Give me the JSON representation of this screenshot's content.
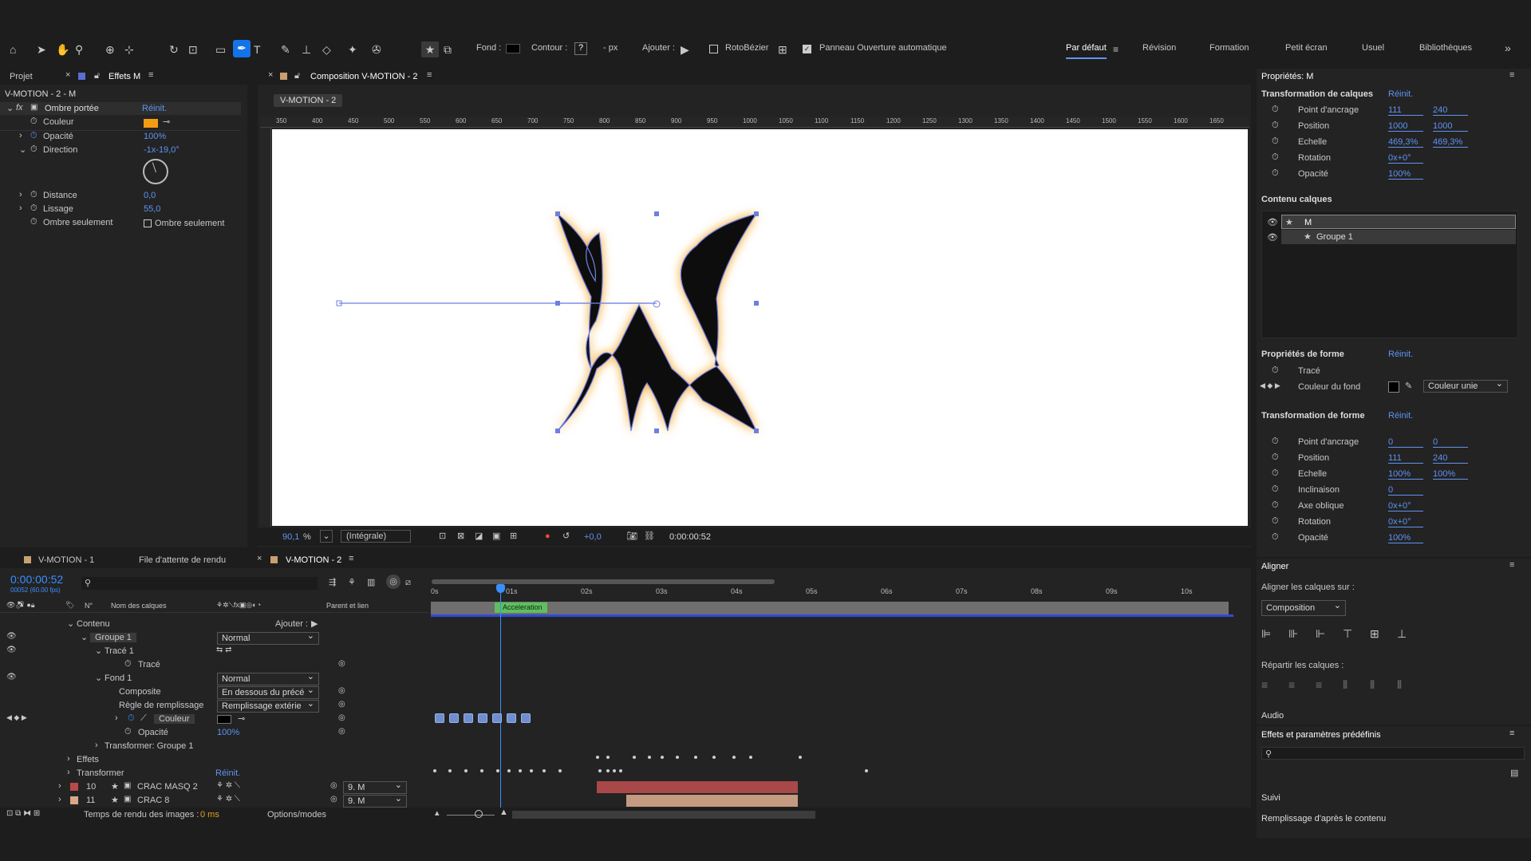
{
  "toolbar": {
    "fill_label": "Fond :",
    "stroke_label": "Contour :",
    "stroke_value": "?",
    "px_label": "- px",
    "add_label": "Ajouter :",
    "roto_label": "RotoBézier",
    "auto_open_label": "Panneau Ouverture automatique",
    "workspaces": [
      "Par défaut",
      "Révision",
      "Formation",
      "Petit écran",
      "Usuel",
      "Bibliothèques"
    ],
    "more": "»"
  },
  "effects_panel": {
    "tab_project": "Projet",
    "tab_effects": "Effets M",
    "title": "V-MOTION - 2 - M",
    "effect_name": "Ombre portée",
    "reset": "Réinit.",
    "rows": [
      {
        "label": "Couleur"
      },
      {
        "label": "Opacité",
        "value": "100%"
      },
      {
        "label": "Direction",
        "value": "-1x-19,0°"
      },
      {
        "label": "Distance",
        "value": "0,0"
      },
      {
        "label": "Lissage",
        "value": "55,0"
      },
      {
        "label": "Ombre seulement",
        "value": "Ombre seulement"
      }
    ]
  },
  "composition": {
    "tab": "Composition V-MOTION - 2",
    "crumb": "V-MOTION - 2",
    "zoom": "90,1",
    "zoom_unit": "%",
    "resolution": "(Intégrale)",
    "exposure": "+0,0",
    "timecode": "0:00:00:52",
    "ruler": [
      "350",
      "400",
      "450",
      "500",
      "550",
      "600",
      "650",
      "700",
      "750",
      "800",
      "850",
      "900",
      "950",
      "1000",
      "1050",
      "1100",
      "1150",
      "1200",
      "1250",
      "1300",
      "1350",
      "1400",
      "1450",
      "1500",
      "1550",
      "1600",
      "1650"
    ]
  },
  "timeline": {
    "tabs": [
      "V-MOTION - 1",
      "File d'attente de rendu",
      "V-MOTION - 2"
    ],
    "timecode": "0:00:00:52",
    "frame_info": "00052 (60.00 fps)",
    "col_num": "N°",
    "col_name": "Nom des calques",
    "col_parent": "Parent et lien",
    "time_labels": [
      "0s",
      "01s",
      "02s",
      "03s",
      "04s",
      "05s",
      "06s",
      "07s",
      "08s",
      "09s",
      "10s"
    ],
    "marker": "Acceleration",
    "rows": [
      {
        "label": "Contenu",
        "extra": "Ajouter :"
      },
      {
        "label": "Groupe 1",
        "mode": "Normal"
      },
      {
        "label": "Tracé 1"
      },
      {
        "label": "Tracé"
      },
      {
        "label": "Fond 1",
        "mode": "Normal"
      },
      {
        "label": "Composite",
        "mode": "En dessous du précé"
      },
      {
        "label": "Règle de remplissage",
        "mode": "Remplissage extérie"
      },
      {
        "label": "Couleur"
      },
      {
        "label": "Opacité",
        "value": "100%"
      },
      {
        "label": "Transformer: Groupe 1"
      },
      {
        "label": "Effets"
      },
      {
        "label": "Transformer",
        "value": "Réinit."
      }
    ],
    "layers": [
      {
        "num": "10",
        "name": "CRAC MASQ 2",
        "parent": "9. M",
        "color": "#b84a4a"
      },
      {
        "num": "11",
        "name": "CRAC 8",
        "parent": "9. M",
        "color": "#d9a88a"
      }
    ],
    "footer_render": "Temps de rendu des images :",
    "footer_render_value": "0 ms",
    "footer_modes": "Options/modes"
  },
  "properties": {
    "title": "Propriétés: M",
    "layer_transform": "Transformation de calques",
    "reset": "Réinit.",
    "transform_rows": [
      {
        "label": "Point d'ancrage",
        "v1": "111",
        "v2": "240"
      },
      {
        "label": "Position",
        "v1": "1000",
        "v2": "1000"
      },
      {
        "label": "Echelle",
        "v1": "469,3%",
        "v2": "469,3%"
      },
      {
        "label": "Rotation",
        "v1": "0x+0°"
      },
      {
        "label": "Opacité",
        "v1": "100%"
      }
    ],
    "layer_content": "Contenu calques",
    "content_items": [
      "M",
      "Groupe 1"
    ],
    "shape_props": "Propriétés de forme",
    "shape_rows": [
      {
        "label": "Tracé"
      },
      {
        "label": "Couleur du fond",
        "select": "Couleur unie"
      }
    ],
    "shape_transform": "Transformation de forme",
    "shape_transform_rows": [
      {
        "label": "Point d'ancrage",
        "v1": "0",
        "v2": "0"
      },
      {
        "label": "Position",
        "v1": "111",
        "v2": "240"
      },
      {
        "label": "Echelle",
        "v1": "100%",
        "v2": "100%"
      },
      {
        "label": "Inclinaison",
        "v1": "0"
      },
      {
        "label": "Axe oblique",
        "v1": "0x+0°"
      },
      {
        "label": "Rotation",
        "v1": "0x+0°"
      },
      {
        "label": "Opacité",
        "v1": "100%"
      }
    ]
  },
  "align": {
    "title": "Aligner",
    "align_to": "Aligner les calques sur :",
    "target": "Composition",
    "distribute": "Répartir les calques :"
  },
  "audio": {
    "title": "Audio"
  },
  "effects_presets": {
    "title": "Effets et paramètres prédéfinis"
  },
  "tracking": {
    "title": "Suivi",
    "content_fill": "Remplissage d'après le contenu"
  }
}
